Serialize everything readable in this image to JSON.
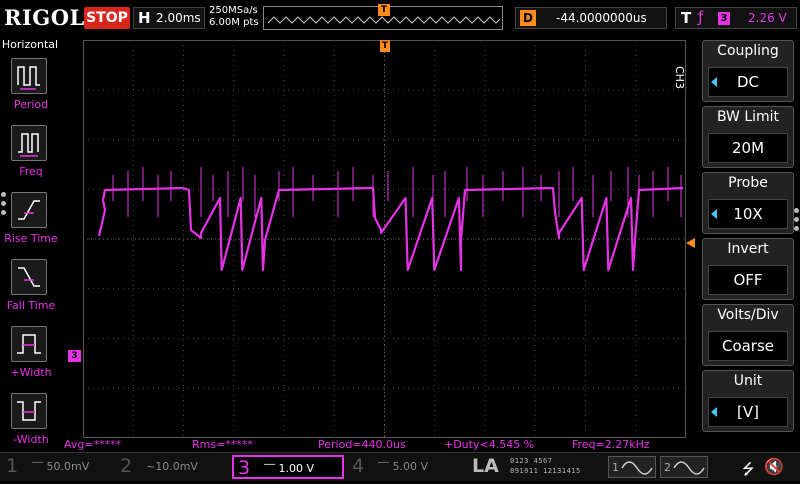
{
  "topbar": {
    "brand": "RIGOL",
    "run_state": "STOP",
    "h_label": "H",
    "timebase": "2.00ms",
    "sample_rate": "250MSa/s",
    "memory_depth": "6.00M pts",
    "trigger_pos_marker": "T",
    "delay_label": "D",
    "delay_value": "-44.0000000us",
    "trig_label": "T",
    "trig_edge_symbol": "ƒ",
    "trig_source": "3",
    "trig_level": "2.26 V"
  },
  "left_menu": {
    "title": "Horizontal",
    "items": [
      {
        "label": "Period"
      },
      {
        "label": "Freq"
      },
      {
        "label": "Rise Time"
      },
      {
        "label": "Fall Time"
      },
      {
        "label": "+Width"
      },
      {
        "label": "-Width"
      }
    ]
  },
  "markers": {
    "trigger_top": "T",
    "ch3_ground": "3"
  },
  "measurements": {
    "avg": "Avg=*****",
    "rms": "Rms=*****",
    "period": "Period=440.0us",
    "duty": "+Duty<4.545 %",
    "freq": "Freq=2.27kHz"
  },
  "right_menu": {
    "channel": "CH3",
    "items": [
      {
        "title": "Coupling",
        "value": "DC",
        "has_arrow": true
      },
      {
        "title": "BW Limit",
        "value": "20M",
        "has_arrow": false
      },
      {
        "title": "Probe",
        "value": "10X",
        "has_arrow": true
      },
      {
        "title": "Invert",
        "value": "OFF",
        "has_arrow": false
      },
      {
        "title": "Volts/Div",
        "value": "Coarse",
        "has_arrow": false
      },
      {
        "title": "Unit",
        "value": "[V]",
        "has_arrow": true
      }
    ]
  },
  "bottombar": {
    "channels": [
      {
        "num": "1",
        "value": "‾‾ 50.0mV"
      },
      {
        "num": "2",
        "value": "~10.0mV"
      },
      {
        "num": "3",
        "value": "‾‾ 1.00 V"
      },
      {
        "num": "4",
        "value": "‾‾ 5.00 V"
      }
    ],
    "la_label": "LA",
    "la_row1": "0123 4567",
    "la_row2": "891011 12131415",
    "gen1": "1",
    "gen2": "2"
  },
  "icons": {
    "usb": "⭍",
    "speaker": "🔇"
  },
  "colors": {
    "ch3": "#e632e6",
    "trigger": "#ff8c1a",
    "stop": "#d8261d",
    "selector_arrow": "#49c6ff"
  }
}
